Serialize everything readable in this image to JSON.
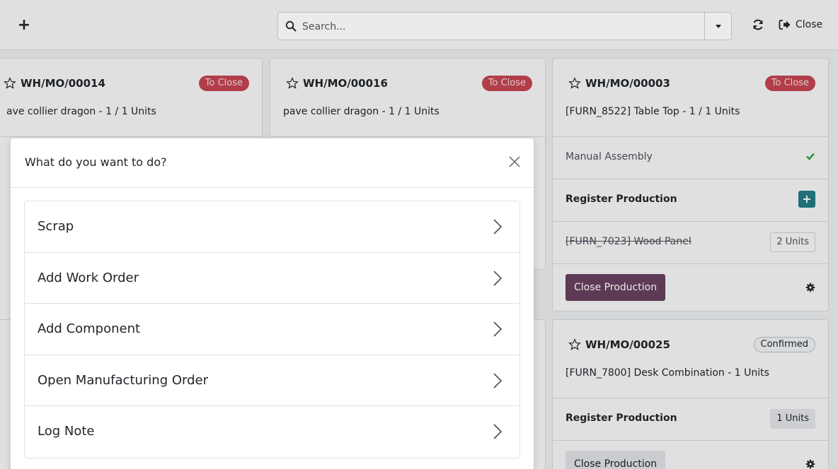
{
  "topbar": {
    "new_icon": "plus-icon",
    "search_placeholder": "Search...",
    "refresh_icon": "refresh-icon",
    "close_label": "Close",
    "close_icon": "sign-out-icon"
  },
  "cards": [
    {
      "ref": "WH/MO/00014",
      "status": "To Close",
      "product": "ave collier dragon - 1 / 1 Units"
    },
    {
      "ref": "WH/MO/00016",
      "status": "To Close",
      "product": "pave collier dragon - 1 / 1 Units"
    },
    {
      "ref": "WH/MO/00003",
      "status": "To Close",
      "product": "[FURN_8522] Table Top - 1 / 1 Units",
      "workorder": "Manual Assembly",
      "register_label": "Register Production",
      "component": "[FURN_7023] Wood Panel",
      "component_qty": "2 Units",
      "close_button": "Close Production"
    },
    {
      "ref": "WH/MO/00025",
      "status": "Confirmed",
      "product": "[FURN_7800] Desk Combination - 1 Units",
      "register_label": "Register Production",
      "register_qty": "1 Units",
      "close_button": "Close Production"
    }
  ],
  "dialog": {
    "title": "What do you want to do?",
    "actions": [
      {
        "label": "Scrap"
      },
      {
        "label": "Add Work Order"
      },
      {
        "label": "Add Component"
      },
      {
        "label": "Open Manufacturing Order"
      },
      {
        "label": "Log Note"
      }
    ]
  },
  "colors": {
    "badge_to_close": "#c0444f",
    "primary_button": "#653f5d",
    "teal_button": "#227a83",
    "check_green": "#28a745"
  }
}
